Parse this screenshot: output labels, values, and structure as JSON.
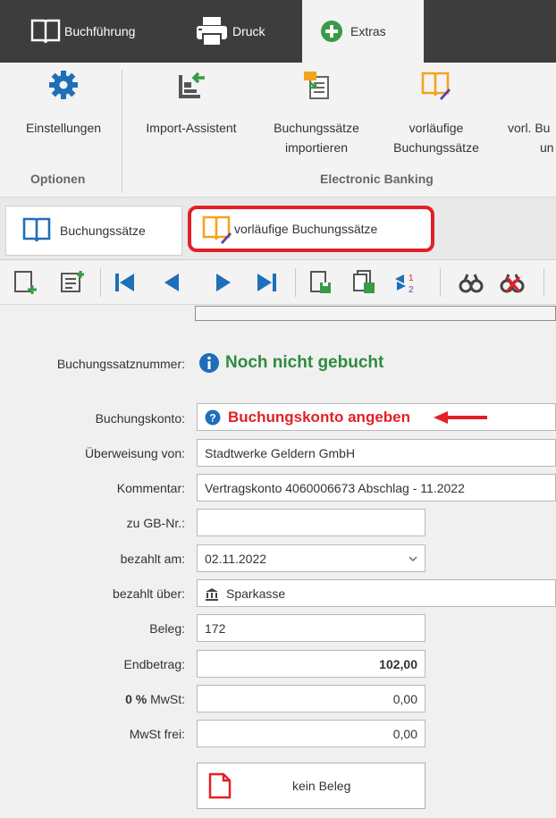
{
  "top_tabs": [
    {
      "label": "Buchführung",
      "icon": "book-icon"
    },
    {
      "label": "Druck",
      "icon": "printer-icon"
    },
    {
      "label": "Extras",
      "icon": "plus-circle-icon"
    }
  ],
  "ribbon": {
    "buttons": [
      {
        "label": "Einstellungen",
        "icon": "gear-icon"
      },
      {
        "label": "Import-Assistent",
        "icon": "import-icon"
      },
      {
        "label_line1": "Buchungssätze",
        "label_line2": "importieren",
        "icon": "import-document-icon"
      },
      {
        "label_line1": "vorläufige",
        "label_line2": "Buchungssätze",
        "icon": "book-edit-icon"
      },
      {
        "label_line1": "vorl. Bu",
        "label_line2": "un",
        "icon": ""
      }
    ],
    "groups": {
      "optionen": "Optionen",
      "electronic_banking": "Electronic Banking"
    }
  },
  "doc_tabs": [
    {
      "label": "Buchungssätze",
      "icon": "book-icon"
    },
    {
      "label": "vorläufige Buchungssätze",
      "icon": "book-edit-icon",
      "highlighted": true
    }
  ],
  "toolbar_icons": [
    "new-record-icon",
    "new-list-icon",
    "first-record-icon",
    "previous-record-icon",
    "next-record-icon",
    "last-record-icon",
    "save-icon",
    "save-all-icon",
    "renumber-icon",
    "search-icon",
    "search-clear-icon"
  ],
  "form": {
    "buchungssatznummer": {
      "label": "Buchungssatznummer:",
      "value": "Noch nicht gebucht"
    },
    "buchungskonto": {
      "label": "Buchungskonto:",
      "value": "Buchungskonto angeben"
    },
    "ueberweisung_von": {
      "label": "Überweisung von:",
      "value": "Stadtwerke Geldern GmbH"
    },
    "kommentar": {
      "label": "Kommentar:",
      "value": "Vertragskonto 4060006673 Abschlag - 11.2022"
    },
    "zu_gb_nr": {
      "label": "zu GB-Nr.:",
      "value": ""
    },
    "bezahlt_am": {
      "label": "bezahlt am:",
      "value": "02.11.2022"
    },
    "bezahlt_ueber": {
      "label": "bezahlt über:",
      "value": "Sparkasse"
    },
    "beleg": {
      "label": "Beleg:",
      "value": "172"
    },
    "endbetrag": {
      "label": "Endbetrag:",
      "value": "102,00"
    },
    "mwst": {
      "label_bold": "0 %",
      "label_rest": " MwSt:",
      "value": "0,00"
    },
    "mwst_frei": {
      "label": "MwSt frei:",
      "value": "0,00"
    },
    "kein_beleg_button": "kein Beleg"
  },
  "colors": {
    "accent_red": "#e41f26",
    "success_green": "#2f8a3f",
    "info_blue": "#1e6fb8",
    "dark_bar": "#3d3d3d"
  }
}
